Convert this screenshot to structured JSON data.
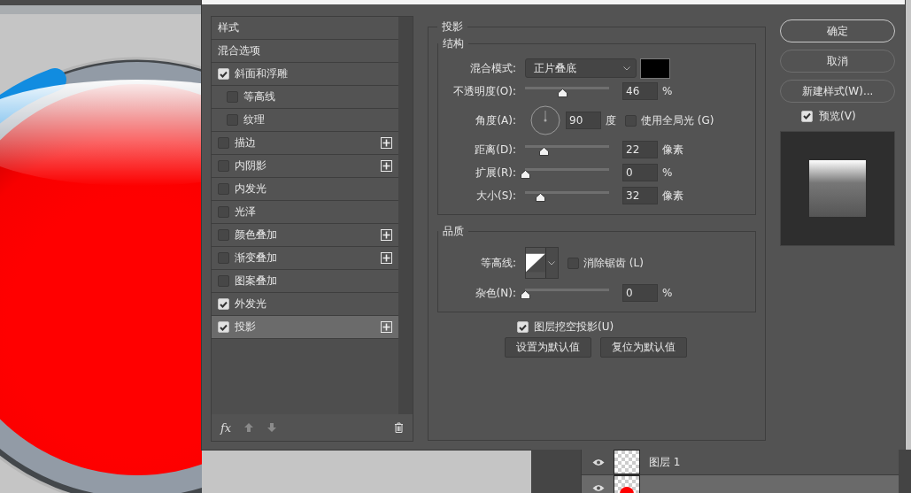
{
  "dialog": {
    "styles_panel": {
      "header": "样式",
      "items": [
        {
          "label": "混合选项",
          "kind": "plain",
          "selected": false
        },
        {
          "label": "斜面和浮雕",
          "kind": "check",
          "checked": true,
          "selected": false,
          "add_button": false,
          "children": [
            {
              "label": "等高线",
              "checked": false,
              "selected": false
            },
            {
              "label": "纹理",
              "checked": false,
              "selected": false
            }
          ]
        },
        {
          "label": "描边",
          "kind": "check",
          "checked": false,
          "selected": false,
          "add_button": true
        },
        {
          "label": "内阴影",
          "kind": "check",
          "checked": false,
          "selected": false,
          "add_button": true
        },
        {
          "label": "内发光",
          "kind": "check",
          "checked": false,
          "selected": false,
          "add_button": false
        },
        {
          "label": "光泽",
          "kind": "check",
          "checked": false,
          "selected": false,
          "add_button": false
        },
        {
          "label": "颜色叠加",
          "kind": "check",
          "checked": false,
          "selected": false,
          "add_button": true
        },
        {
          "label": "渐变叠加",
          "kind": "check",
          "checked": false,
          "selected": false,
          "add_button": true
        },
        {
          "label": "图案叠加",
          "kind": "check",
          "checked": false,
          "selected": false,
          "add_button": false
        },
        {
          "label": "外发光",
          "kind": "check",
          "checked": true,
          "selected": false,
          "add_button": false
        },
        {
          "label": "投影",
          "kind": "check",
          "checked": true,
          "selected": true,
          "add_button": true
        }
      ],
      "fx": "fx"
    },
    "drop_shadow": {
      "title": "投影",
      "structure": {
        "title": "结构",
        "blend_mode": {
          "label": "混合模式:",
          "value": "正片叠底"
        },
        "opacity": {
          "label": "不透明度(O):",
          "level": 0.44,
          "value": "46",
          "unit": "%"
        },
        "angle": {
          "label": "角度(A):",
          "value": "90",
          "unit": "度",
          "use_global_light": {
            "label": "使用全局光 (G)",
            "checked": false
          }
        },
        "distance": {
          "label": "距离(D):",
          "level": 0.22,
          "value": "22",
          "unit": "像素"
        },
        "spread": {
          "label": "扩展(R):",
          "level": 0,
          "value": "0",
          "unit": "%"
        },
        "size": {
          "label": "大小(S):",
          "level": 0.18,
          "value": "32",
          "unit": "像素"
        }
      },
      "quality": {
        "title": "品质",
        "contour": {
          "label": "等高线:"
        },
        "anti_aliased": {
          "label": "消除锯齿 (L)",
          "checked": false
        },
        "noise": {
          "label": "杂色(N):",
          "level": 0,
          "value": "0",
          "unit": "%"
        }
      },
      "knockout": {
        "label": "图层挖空投影(U)",
        "checked": true
      },
      "buttons": [
        "设置为默认值",
        "复位为默认值"
      ]
    },
    "actions": {
      "buttons": [
        {
          "label": "确定",
          "kind": "primary"
        },
        {
          "label": "取消",
          "kind": "normal"
        },
        {
          "label": "新建样式(W)...",
          "kind": "normal"
        }
      ],
      "preview": {
        "label": "预览(V)",
        "checked": true
      }
    }
  },
  "layers_panel": {
    "layers": [
      {
        "name": "图层 1",
        "visible": true,
        "selected": false,
        "kind": "empty"
      },
      {
        "visible": true,
        "selected": true,
        "kind": "ellipse"
      }
    ]
  }
}
